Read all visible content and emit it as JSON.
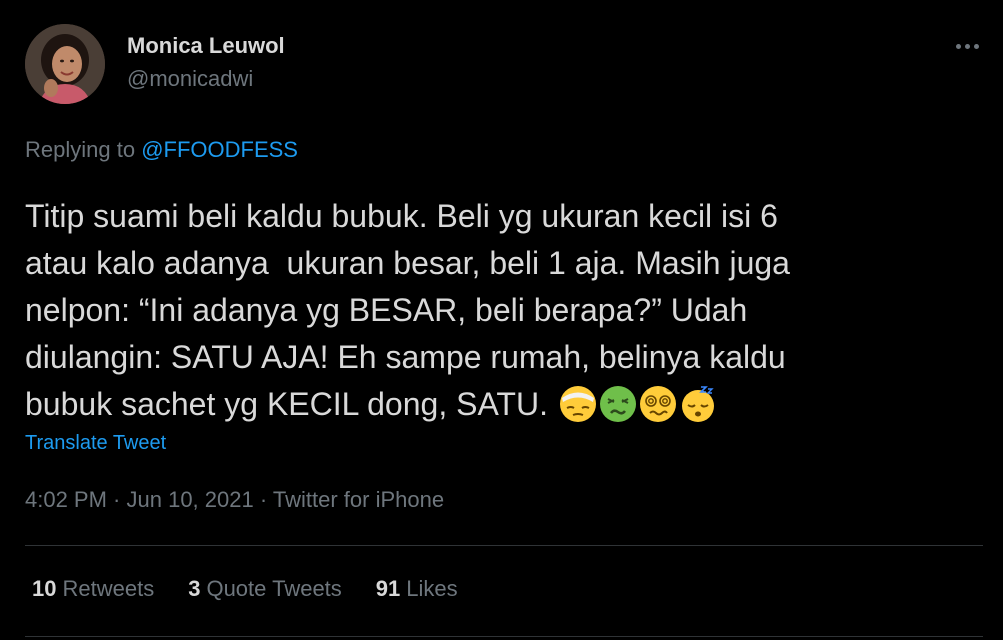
{
  "author": {
    "name": "Monica Leuwol",
    "handle": "@monicadwi",
    "avatar": "profile-photo"
  },
  "more_icon": "more-horizontal-icon",
  "reply": {
    "prefix": "Replying to ",
    "mention": "@FFOODFESS"
  },
  "tweet": {
    "lines": [
      "Titip suami beli kaldu bubuk. Beli yg ukuran kecil isi 6",
      "atau kalo adanya  ukuran besar, beli 1 aja. Masih juga",
      "nelpon: “Ini adanya yg BESAR, beli berapa?” Udah",
      "diulangin: SATU AJA! Eh sampe rumah, belinya kaldu",
      "bubuk sachet yg KECIL dong, SATU. "
    ],
    "emojis": [
      "face-with-head-bandage",
      "nauseated-face",
      "face-with-spiral-eyes",
      "sleeping-face"
    ]
  },
  "translate_label": "Translate Tweet",
  "meta": {
    "time": "4:02 PM",
    "sep1": " · ",
    "date": "Jun 10, 2021",
    "sep2": " · ",
    "source": "Twitter for iPhone"
  },
  "stats": [
    {
      "count": "10",
      "label": "Retweets"
    },
    {
      "count": "3",
      "label": "Quote Tweets"
    },
    {
      "count": "91",
      "label": "Likes"
    }
  ],
  "colors": {
    "background": "#000000",
    "text": "#d9d9d9",
    "secondary": "#6e767d",
    "link": "#1d9bf0",
    "divider": "#2f3336"
  }
}
